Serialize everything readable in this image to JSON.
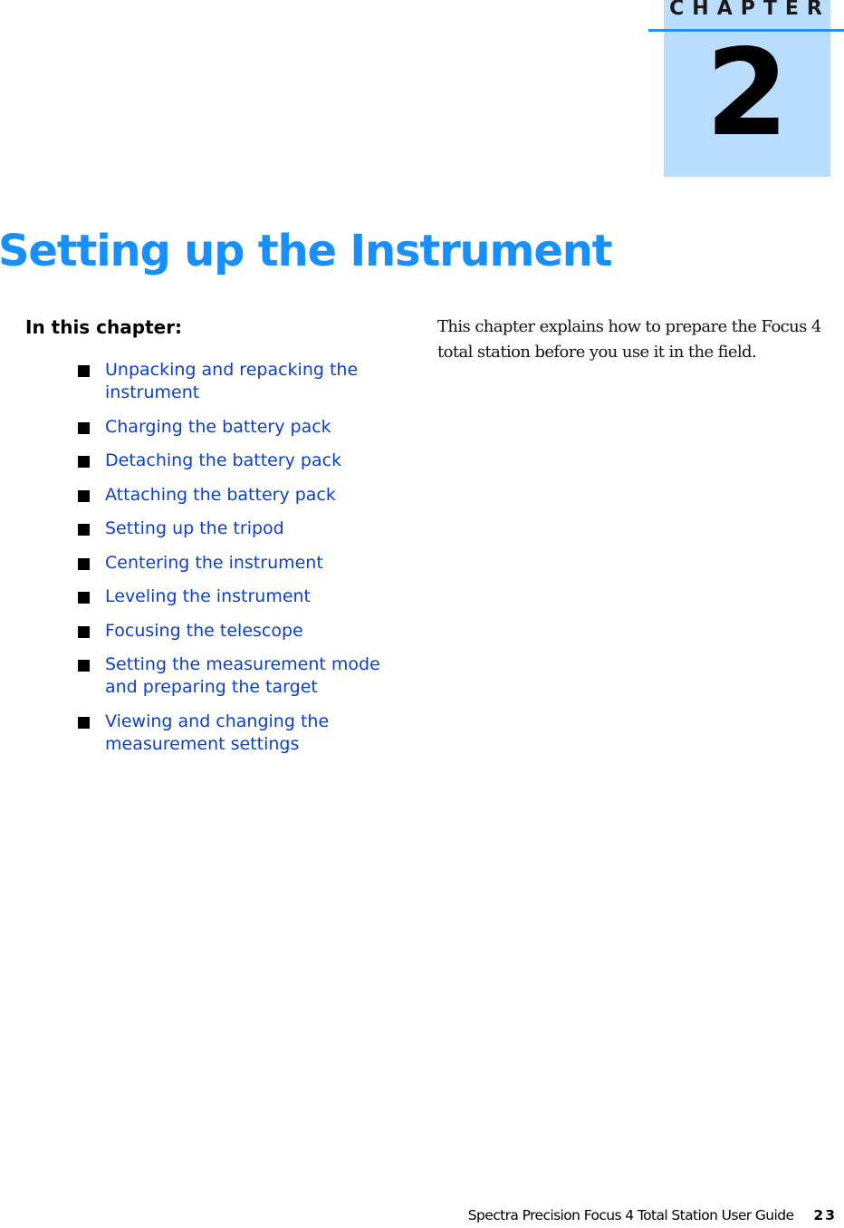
{
  "header": {
    "chapter_label": "CHAPTER",
    "chapter_number": "2"
  },
  "page_title": "Setting up the Instrument",
  "in_this_chapter": {
    "heading": "In this chapter:",
    "items": [
      {
        "label": "Unpacking and repacking the instrument"
      },
      {
        "label": "Charging the battery pack"
      },
      {
        "label": "Detaching the battery pack"
      },
      {
        "label": "Attaching the battery pack"
      },
      {
        "label": "Setting up the tripod"
      },
      {
        "label": "Centering the instrument"
      },
      {
        "label": "Leveling the instrument"
      },
      {
        "label": "Focusing the telescope"
      },
      {
        "label": "Setting the measurement mode and preparing the target"
      },
      {
        "label": "Viewing and changing the measurement settings"
      }
    ]
  },
  "intro": "This chapter explains how to prepare the Focus 4 total station before you use it in the field.",
  "footer": {
    "title": "Spectra Precision Focus 4 Total Station User Guide",
    "page_number": "23"
  },
  "colors": {
    "title_blue": "#1790fd",
    "link_blue": "#0b3fd0",
    "chapter_box": "#bbddfd",
    "rule_blue": "#2a8ef7"
  }
}
